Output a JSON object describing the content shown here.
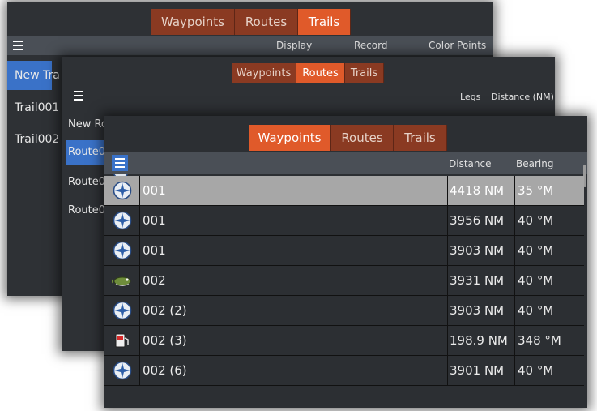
{
  "trails_panel": {
    "tabs": [
      "Waypoints",
      "Routes",
      "Trails"
    ],
    "active_tab": 2,
    "columns": [
      "Display",
      "Record",
      "Color Points"
    ],
    "items": [
      "New Tra",
      "Trail001",
      "Trail002"
    ]
  },
  "routes_panel": {
    "tabs": [
      "Waypoints",
      "Routes",
      "Trails"
    ],
    "active_tab": 1,
    "columns": [
      "Legs",
      "Distance (NM)"
    ],
    "items": [
      "New Ro",
      "Route0",
      "Route0",
      "Route0"
    ]
  },
  "waypoints_panel": {
    "tabs": [
      "Waypoints",
      "Routes",
      "Trails"
    ],
    "active_tab": 0,
    "columns": [
      "Distance",
      "Bearing"
    ],
    "rows": [
      {
        "icon": "crosshair-waypoint-icon",
        "name": "001",
        "distance": "4418 NM",
        "bearing": "35 °M",
        "selected": true
      },
      {
        "icon": "crosshair-waypoint-icon",
        "name": "001",
        "distance": "3956 NM",
        "bearing": "40 °M"
      },
      {
        "icon": "crosshair-waypoint-icon",
        "name": "001",
        "distance": "3903 NM",
        "bearing": "40 °M"
      },
      {
        "icon": "fish-waypoint-icon",
        "name": "002",
        "distance": "3931 NM",
        "bearing": "40 °M"
      },
      {
        "icon": "crosshair-waypoint-icon",
        "name": "002 (2)",
        "distance": "3903 NM",
        "bearing": "40 °M"
      },
      {
        "icon": "fuel-waypoint-icon",
        "name": "002 (3)",
        "distance": "198.9 NM",
        "bearing": "348 °M"
      },
      {
        "icon": "crosshair-waypoint-icon",
        "name": "002 (6)",
        "distance": "3901 NM",
        "bearing": "40 °M"
      }
    ]
  },
  "colors": {
    "tab_active": "#e05a2a",
    "tab_inactive": "#8a3a22",
    "menu_button": "#3a72c8",
    "selected_row": "#a7a7a7"
  }
}
